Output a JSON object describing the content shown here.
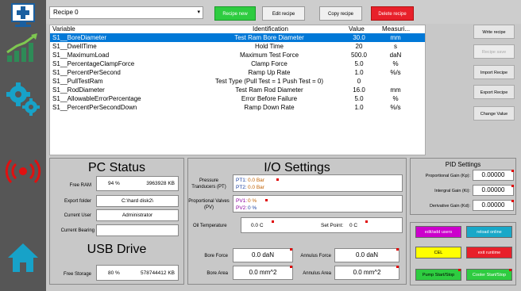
{
  "recipe": {
    "selected": "Recipe 0",
    "buttons": {
      "new": "Recipe new",
      "edit": "Edit recipe",
      "copy": "Copy recipe",
      "delete": "Delete recipe"
    }
  },
  "table": {
    "headers": {
      "variable": "Variable",
      "identification": "Identification",
      "value": "Value",
      "measure": "Measuri..."
    },
    "rows": [
      {
        "variable": "S1__BoreDiameter",
        "identification": "Test Ram Bore Diameter",
        "value": "30.0",
        "unit": "mm"
      },
      {
        "variable": "S1__DwellTime",
        "identification": "Hold Time",
        "value": "20",
        "unit": "s"
      },
      {
        "variable": "S1__MaximumLoad",
        "identification": "Maximum Test Force",
        "value": "500.0",
        "unit": "daN"
      },
      {
        "variable": "S1__PercentageClampForce",
        "identification": "Clamp Force",
        "value": "5.0",
        "unit": "%"
      },
      {
        "variable": "S1__PercentPerSecond",
        "identification": "Ramp Up Rate",
        "value": "1.0",
        "unit": "%/s"
      },
      {
        "variable": "S1__PullTestRam",
        "identification": "Test Type (Pull Test = 1 Push Test = 0)",
        "value": "0",
        "unit": ""
      },
      {
        "variable": "S1__RodDiameter",
        "identification": "Test Ram Rod Diameter",
        "value": "16.0",
        "unit": "mm"
      },
      {
        "variable": "S1__AllowableErrorPercentage",
        "identification": "Error Before Failure",
        "value": "5.0",
        "unit": "%"
      },
      {
        "variable": "S1__PercentPerSecondDown",
        "identification": "Ramp Down Rate",
        "value": "1.0",
        "unit": "%/s"
      }
    ]
  },
  "side_buttons": {
    "write": "Write recipe",
    "save": "Recipe save",
    "import": "Import Recipe",
    "export": "Export Recipe",
    "change": "Change Value"
  },
  "pc_status": {
    "title": "PC Status",
    "free_ram_label": "Free RAM",
    "free_ram_pct": "94 %",
    "free_ram_kb": "3963928 KB",
    "export_label": "Export folder",
    "export_value": "C:\\hard disk2\\",
    "user_label": "Current User",
    "user_value": "Administrator",
    "bearing_label": "Current Bearing",
    "bearing_value": ""
  },
  "usb": {
    "title": "USB Drive",
    "storage_label": "Free Storage",
    "storage_pct": "80 %",
    "storage_kb": "578744412 KB"
  },
  "io": {
    "title": "I/O Settings",
    "pt_label": "Pressure Tranducers (PT)",
    "pt1": "PT1:",
    "pt1_val": "0.0 Bar",
    "pt2": "PT2:",
    "pt2_val": "0.0 Bar",
    "pv_label": "Proportional Valves (PV)",
    "pv1": "PV1:",
    "pv1_val": "0 %",
    "pv2": "PV2:",
    "pv2_val": "0 %",
    "oil_label": "Oil Temperature",
    "oil_val": "0.0 C",
    "setpoint_label": "Set Point:",
    "setpoint_val": "0 C",
    "bore_force_label": "Bore Force",
    "bore_force": "0.0 daN",
    "annulus_force_label": "Annulus Force",
    "annulus_force": "0.0 daN",
    "bore_area_label": "Bore Area",
    "bore_area": "0.0 mm^2",
    "annulus_area_label": "Annulus Area",
    "annulus_area": "0.0 mm^2"
  },
  "pid": {
    "title": "PID Settings",
    "kp_label": "Proportional Gain (Kp):",
    "kp": "0.00000",
    "ki_label": "Intergral Gain (Ki):",
    "ki": "0.00000",
    "kd_label": "Derivative Gain (Kd):",
    "kd": "0.00000"
  },
  "controls": {
    "edit_users": "edit/add users",
    "reload": "reload online",
    "cel": "CEL",
    "exit": "exit runtime",
    "pump": "Pump Start/Stop",
    "cooler": "Cooler Start/Stop"
  },
  "colors": {
    "selected_row": "#0078d7",
    "green": "#2ecc40",
    "red": "#e8202a",
    "magenta": "#cc00cc",
    "cyan": "#19a8c8",
    "yellow": "#ffff00",
    "sidebar": "#565656"
  },
  "icons": [
    "monitor-plus-icon",
    "growth-chart-icon",
    "gears-icon",
    "wireless-signal-icon",
    "home-icon"
  ]
}
